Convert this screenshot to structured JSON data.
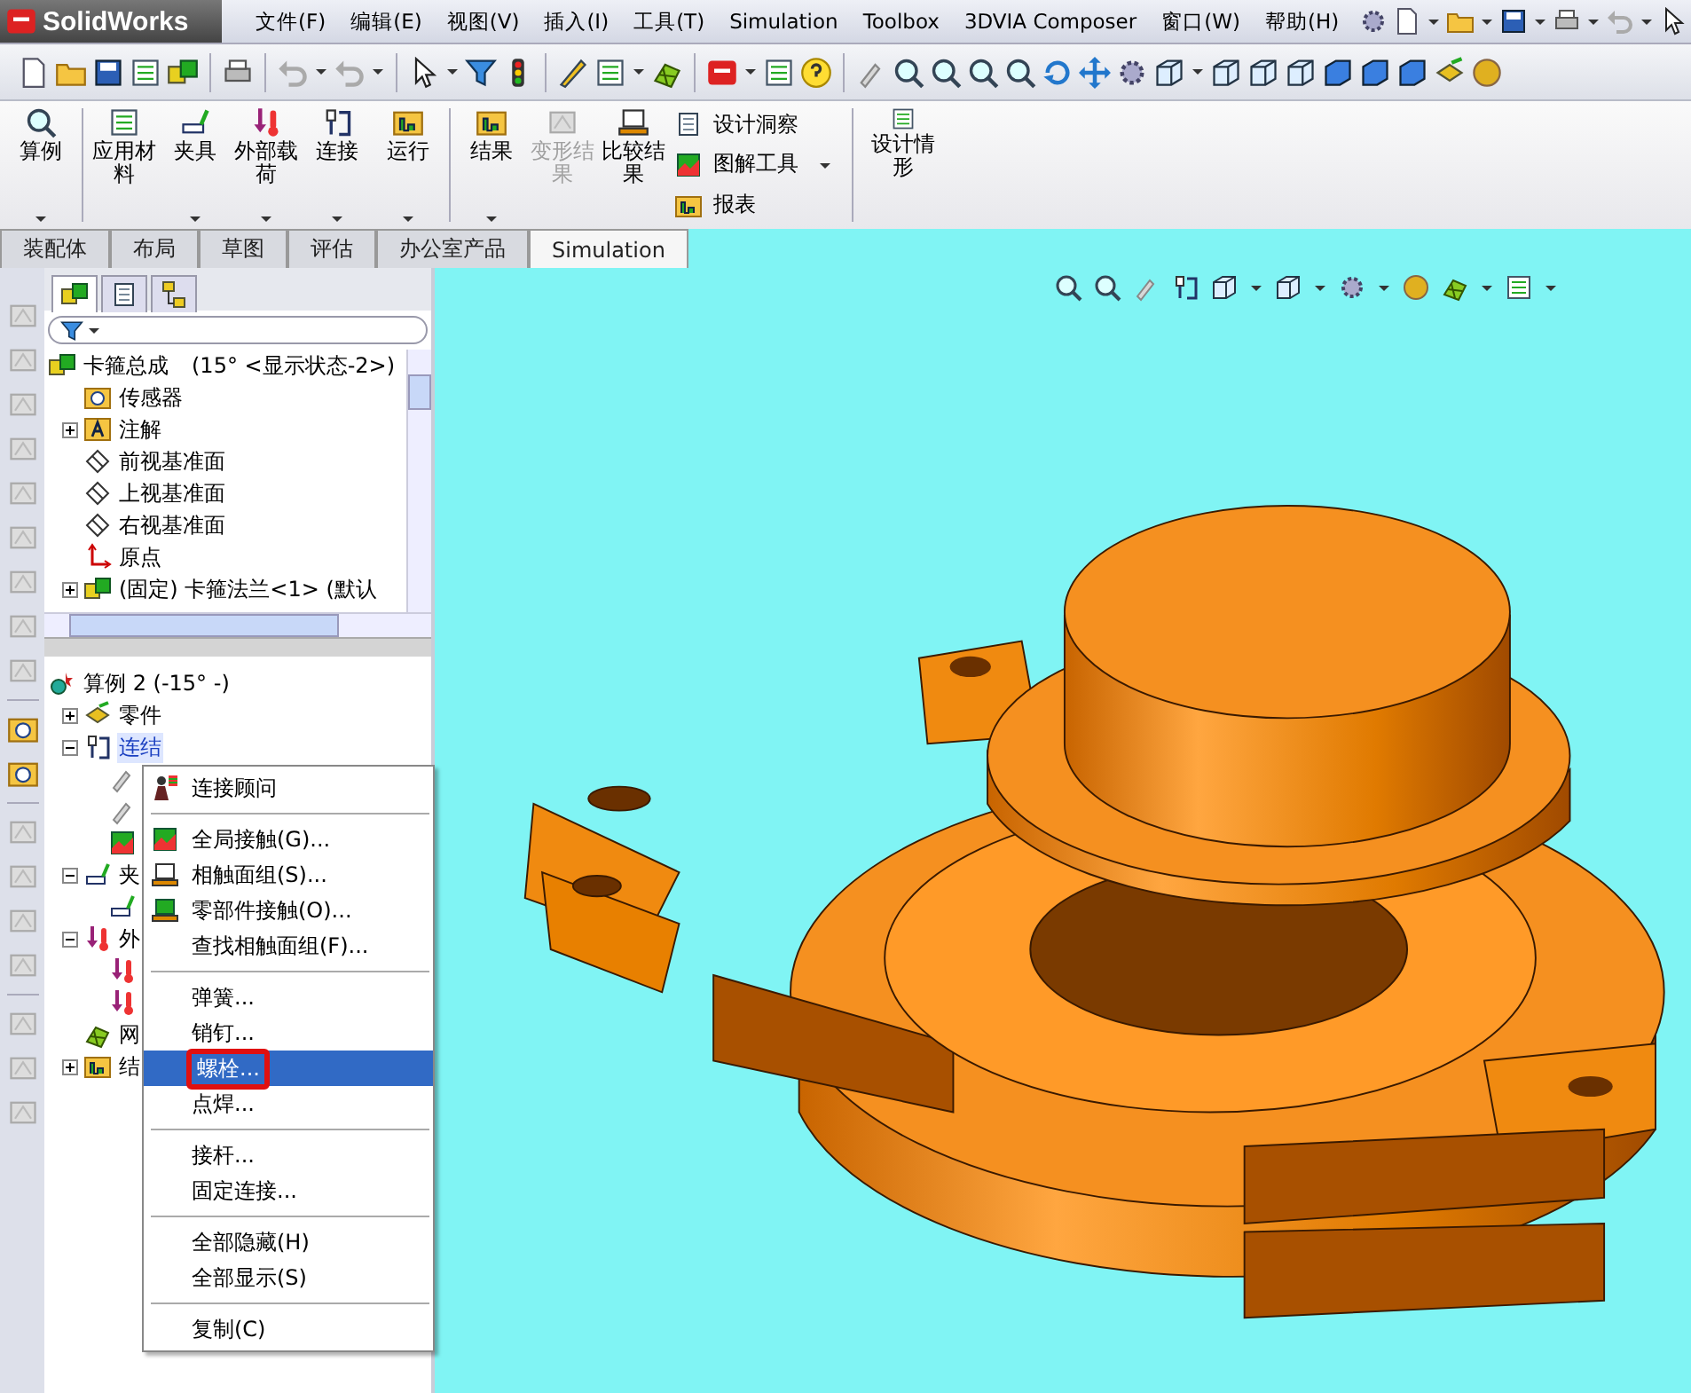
{
  "title_bar": {
    "logo": "SolidWorks"
  },
  "menu": [
    "文件(F)",
    "编辑(E)",
    "视图(V)",
    "插入(I)",
    "工具(T)",
    "Simulation",
    "Toolbox",
    "3DVIA Composer",
    "窗口(W)",
    "帮助(H)"
  ],
  "ribbon": {
    "buttons": [
      {
        "label": "算例",
        "disabled": false,
        "dropdown": true
      },
      {
        "label": "应用材料",
        "disabled": false,
        "dropdown": false
      },
      {
        "label": "夹具",
        "disabled": false,
        "dropdown": true
      },
      {
        "label": "外部载荷",
        "disabled": false,
        "dropdown": true
      },
      {
        "label": "连接",
        "disabled": false,
        "dropdown": true
      },
      {
        "label": "运行",
        "disabled": false,
        "dropdown": true
      },
      {
        "label": "结果",
        "disabled": false,
        "dropdown": true
      },
      {
        "label": "变形结果",
        "disabled": true,
        "dropdown": false
      },
      {
        "label": "比较结果",
        "disabled": false,
        "dropdown": false
      }
    ],
    "side_items": [
      "设计洞察",
      "图解工具",
      "报表"
    ],
    "last_button": {
      "label": "设计情形"
    }
  },
  "tabs": [
    {
      "label": "装配体",
      "selected": false
    },
    {
      "label": "布局",
      "selected": false
    },
    {
      "label": "草图",
      "selected": false
    },
    {
      "label": "评估",
      "selected": false
    },
    {
      "label": "办公室产品",
      "selected": false
    },
    {
      "label": "Simulation",
      "selected": true
    }
  ],
  "feature_tree": {
    "root": "卡箍总成",
    "config": "(15° <显示状态-2>)",
    "items": [
      {
        "label": "传感器",
        "kind": "leaf"
      },
      {
        "label": "注解",
        "kind": "collapsed"
      },
      {
        "label": "前视基准面",
        "kind": "leaf"
      },
      {
        "label": "上视基准面",
        "kind": "leaf"
      },
      {
        "label": "右视基准面",
        "kind": "leaf"
      },
      {
        "label": "原点",
        "kind": "leaf"
      },
      {
        "label": "(固定) 卡箍法兰<1> (默认",
        "kind": "collapsed"
      }
    ]
  },
  "study_tree": {
    "root": "算例 2 (-15° -)",
    "items": [
      {
        "label": "零件",
        "kind": "collapsed",
        "selected": false
      },
      {
        "label": "连结",
        "kind": "expanded",
        "selected": true,
        "children": [
          {
            "kind": "pin"
          },
          {
            "kind": "pin"
          },
          {
            "kind": "contact"
          }
        ]
      },
      {
        "label": "夹",
        "kind": "expanded",
        "selected": false,
        "children": [
          {
            "kind": "fixture"
          }
        ]
      },
      {
        "label": "外",
        "kind": "expanded",
        "selected": false,
        "children": [
          {
            "kind": "load"
          },
          {
            "kind": "load"
          }
        ]
      },
      {
        "label": "网",
        "kind": "leaf",
        "selected": false
      },
      {
        "label": "结",
        "kind": "collapsed",
        "selected": false
      }
    ]
  },
  "context_menu": {
    "groups": [
      [
        {
          "label": "连接顾问",
          "selected": false,
          "outlined": false
        }
      ],
      [
        {
          "label": "全局接触(G)...",
          "selected": false,
          "outlined": false
        },
        {
          "label": "相触面组(S)...",
          "selected": false,
          "outlined": false
        },
        {
          "label": "零部件接触(O)...",
          "selected": false,
          "outlined": false
        },
        {
          "label": "查找相触面组(F)...",
          "selected": false,
          "outlined": false
        }
      ],
      [
        {
          "label": "弹簧...",
          "selected": false,
          "outlined": false
        },
        {
          "label": "销钉...",
          "selected": false,
          "outlined": false
        },
        {
          "label": "螺栓...",
          "selected": true,
          "outlined": true
        },
        {
          "label": "点焊...",
          "selected": false,
          "outlined": false
        }
      ],
      [
        {
          "label": "接杆...",
          "selected": false,
          "outlined": false
        },
        {
          "label": "固定连接...",
          "selected": false,
          "outlined": false
        }
      ],
      [
        {
          "label": "全部隐藏(H)",
          "selected": false,
          "outlined": false
        },
        {
          "label": "全部显示(S)",
          "selected": false,
          "outlined": false
        }
      ],
      [
        {
          "label": "复制(C)",
          "selected": false,
          "outlined": false
        }
      ]
    ]
  }
}
